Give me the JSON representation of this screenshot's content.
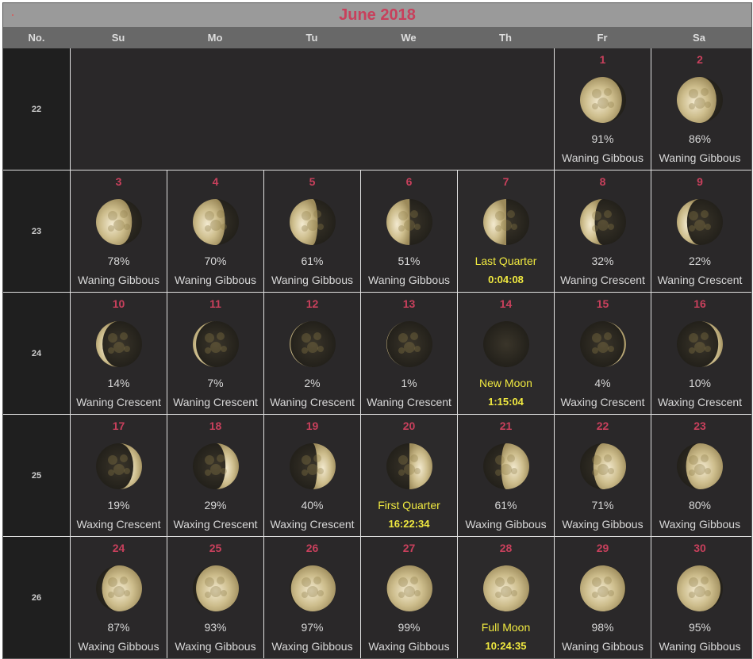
{
  "title": "June 2018",
  "colors": {
    "accent": "#c8405c",
    "key_phase": "#f0e940",
    "text": "#d8d8d8",
    "header_bg": "#9a9a9a",
    "weekday_bg": "#686868",
    "cell_bg": "#2a2829"
  },
  "header": {
    "no_label": "No.",
    "weekdays": [
      "Su",
      "Mo",
      "Tu",
      "We",
      "Th",
      "Fr",
      "Sa"
    ]
  },
  "weeks": [
    {
      "no": "22",
      "days": [
        null,
        null,
        null,
        null,
        null,
        {
          "day": "1",
          "illum": 0.91,
          "waxing": false,
          "l1": "91%",
          "l2": "Waning Gibbous"
        },
        {
          "day": "2",
          "illum": 0.86,
          "waxing": false,
          "l1": "86%",
          "l2": "Waning Gibbous"
        }
      ]
    },
    {
      "no": "23",
      "days": [
        {
          "day": "3",
          "illum": 0.78,
          "waxing": false,
          "l1": "78%",
          "l2": "Waning Gibbous"
        },
        {
          "day": "4",
          "illum": 0.7,
          "waxing": false,
          "l1": "70%",
          "l2": "Waning Gibbous"
        },
        {
          "day": "5",
          "illum": 0.61,
          "waxing": false,
          "l1": "61%",
          "l2": "Waning Gibbous"
        },
        {
          "day": "6",
          "illum": 0.51,
          "waxing": false,
          "l1": "51%",
          "l2": "Waning Gibbous"
        },
        {
          "day": "7",
          "illum": 0.5,
          "waxing": false,
          "key": true,
          "l1": "Last Quarter",
          "l2": "0:04:08"
        },
        {
          "day": "8",
          "illum": 0.32,
          "waxing": false,
          "l1": "32%",
          "l2": "Waning Crescent"
        },
        {
          "day": "9",
          "illum": 0.22,
          "waxing": false,
          "l1": "22%",
          "l2": "Waning Crescent"
        }
      ]
    },
    {
      "no": "24",
      "days": [
        {
          "day": "10",
          "illum": 0.14,
          "waxing": false,
          "l1": "14%",
          "l2": "Waning Crescent"
        },
        {
          "day": "11",
          "illum": 0.07,
          "waxing": false,
          "l1": "7%",
          "l2": "Waning Crescent"
        },
        {
          "day": "12",
          "illum": 0.02,
          "waxing": false,
          "l1": "2%",
          "l2": "Waning Crescent"
        },
        {
          "day": "13",
          "illum": 0.01,
          "waxing": false,
          "l1": "1%",
          "l2": "Waning Crescent"
        },
        {
          "day": "14",
          "illum": 0.0,
          "waxing": true,
          "key": true,
          "l1": "New Moon",
          "l2": "1:15:04"
        },
        {
          "day": "15",
          "illum": 0.04,
          "waxing": true,
          "l1": "4%",
          "l2": "Waxing Crescent"
        },
        {
          "day": "16",
          "illum": 0.1,
          "waxing": true,
          "l1": "10%",
          "l2": "Waxing Crescent"
        }
      ]
    },
    {
      "no": "25",
      "days": [
        {
          "day": "17",
          "illum": 0.19,
          "waxing": true,
          "l1": "19%",
          "l2": "Waxing Crescent"
        },
        {
          "day": "18",
          "illum": 0.29,
          "waxing": true,
          "l1": "29%",
          "l2": "Waxing Crescent"
        },
        {
          "day": "19",
          "illum": 0.4,
          "waxing": true,
          "l1": "40%",
          "l2": "Waxing Crescent"
        },
        {
          "day": "20",
          "illum": 0.5,
          "waxing": true,
          "key": true,
          "l1": "First Quarter",
          "l2": "16:22:34"
        },
        {
          "day": "21",
          "illum": 0.61,
          "waxing": true,
          "l1": "61%",
          "l2": "Waxing Gibbous"
        },
        {
          "day": "22",
          "illum": 0.71,
          "waxing": true,
          "l1": "71%",
          "l2": "Waxing Gibbous"
        },
        {
          "day": "23",
          "illum": 0.8,
          "waxing": true,
          "l1": "80%",
          "l2": "Waxing Gibbous"
        }
      ]
    },
    {
      "no": "26",
      "days": [
        {
          "day": "24",
          "illum": 0.87,
          "waxing": true,
          "l1": "87%",
          "l2": "Waxing Gibbous"
        },
        {
          "day": "25",
          "illum": 0.93,
          "waxing": true,
          "l1": "93%",
          "l2": "Waxing Gibbous"
        },
        {
          "day": "26",
          "illum": 0.97,
          "waxing": true,
          "l1": "97%",
          "l2": "Waxing Gibbous"
        },
        {
          "day": "27",
          "illum": 0.99,
          "waxing": true,
          "l1": "99%",
          "l2": "Waxing Gibbous"
        },
        {
          "day": "28",
          "illum": 1.0,
          "waxing": true,
          "key": true,
          "l1": "Full Moon",
          "l2": "10:24:35"
        },
        {
          "day": "29",
          "illum": 0.98,
          "waxing": false,
          "l1": "98%",
          "l2": "Waning Gibbous"
        },
        {
          "day": "30",
          "illum": 0.95,
          "waxing": false,
          "l1": "95%",
          "l2": "Waning Gibbous"
        }
      ]
    }
  ]
}
